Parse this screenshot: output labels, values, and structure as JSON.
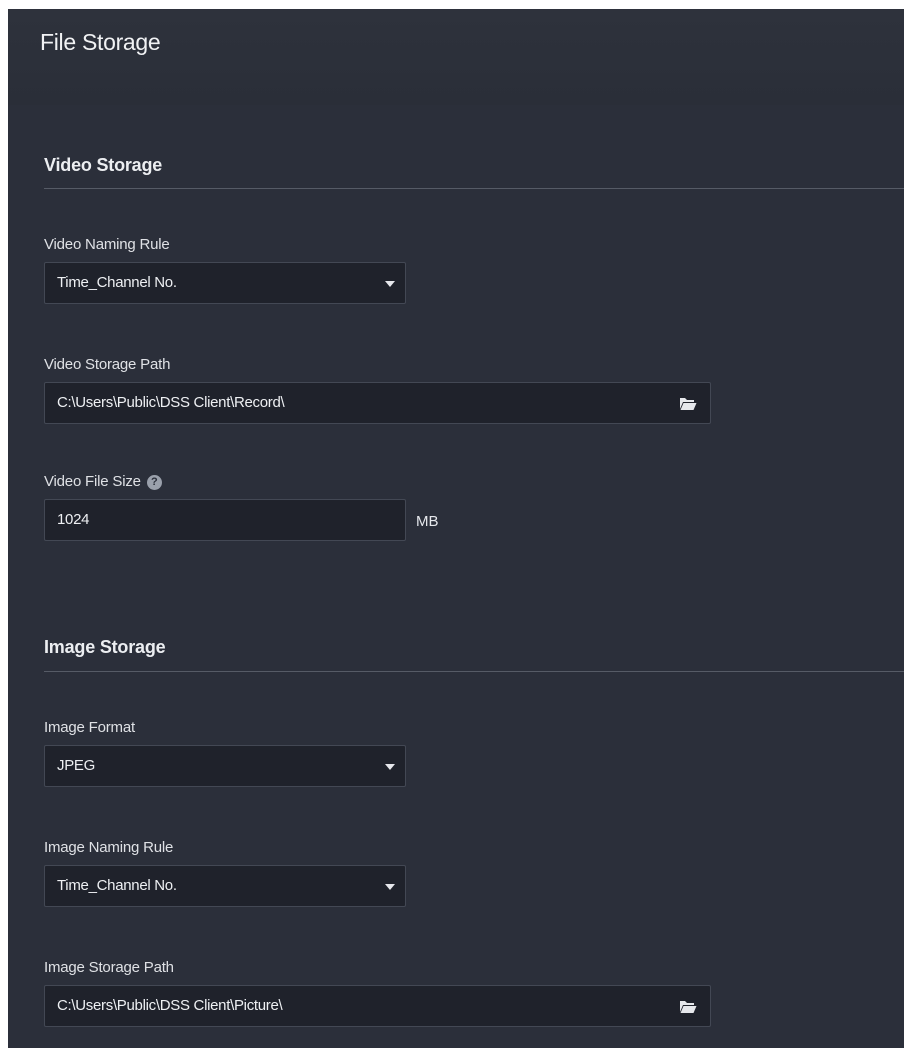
{
  "page": {
    "title": "File Storage"
  },
  "video_storage": {
    "section_title": "Video Storage",
    "naming_rule": {
      "label": "Video Naming Rule",
      "value": "Time_Channel No."
    },
    "storage_path": {
      "label": "Video Storage Path",
      "value": "C:\\Users\\Public\\DSS Client\\Record\\"
    },
    "file_size": {
      "label": "Video File Size",
      "value": "1024",
      "unit": "MB",
      "help_icon": "question-circle-icon"
    }
  },
  "image_storage": {
    "section_title": "Image Storage",
    "format": {
      "label": "Image Format",
      "value": "JPEG"
    },
    "naming_rule": {
      "label": "Image Naming Rule",
      "value": "Time_Channel No."
    },
    "storage_path": {
      "label": "Image Storage Path",
      "value": "C:\\Users\\Public\\DSS Client\\Picture\\"
    }
  },
  "icons": {
    "dropdown": "chevron-down-icon",
    "browse": "folder-open-icon",
    "help": "question-circle-icon"
  },
  "colors": {
    "panel_bg": "#2b2f3a",
    "field_bg": "#1f222b",
    "field_border": "#434854",
    "divider": "#565b66",
    "text": "#e6e8ec"
  }
}
